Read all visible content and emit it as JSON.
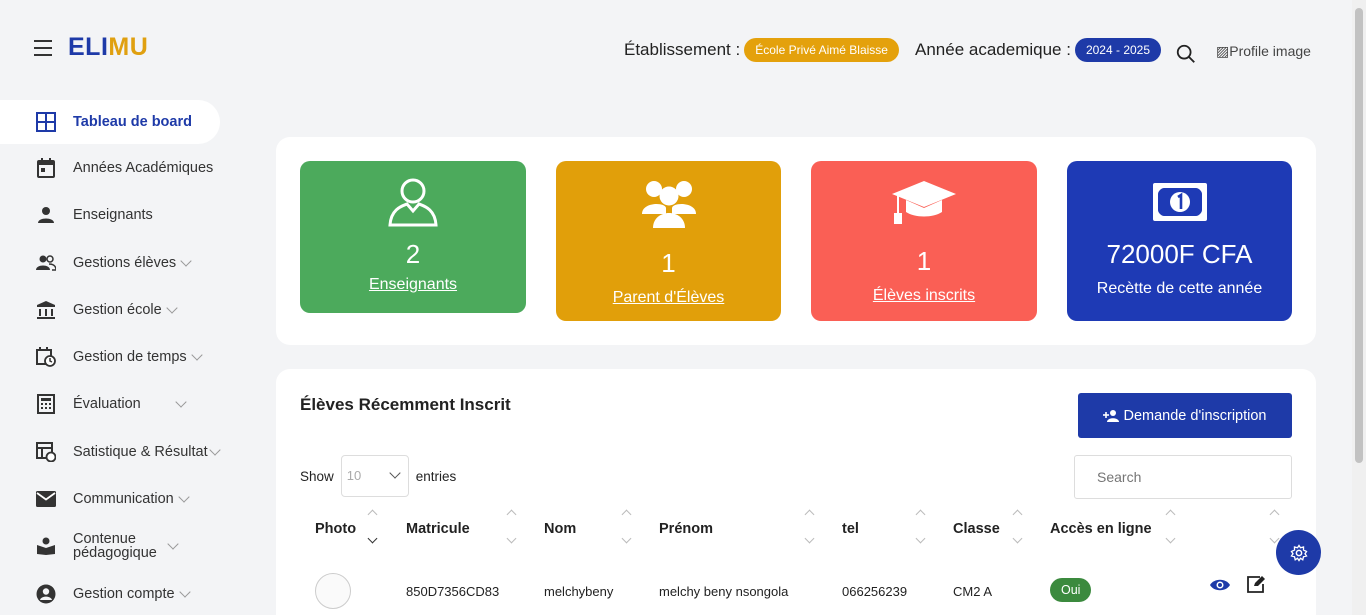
{
  "header": {
    "logo_part1": "ELI",
    "logo_part2": "MU",
    "etablissement_label": "Établissement :",
    "etablissement_value": "École Privé Aimé Blaisse",
    "annee_label": "Année academique :",
    "annee_value": "2024 - 2025",
    "profile_alt": "Profile image"
  },
  "sidebar": {
    "items": [
      {
        "label": "Tableau de board",
        "icon": "dashboard-icon"
      },
      {
        "label": "Années Académiques",
        "icon": "calendar-icon"
      },
      {
        "label": "Enseignants",
        "icon": "person-icon"
      },
      {
        "label": "Gestions élèves",
        "icon": "group-icon"
      },
      {
        "label": "Gestion école",
        "icon": "bank-icon"
      },
      {
        "label": "Gestion de temps",
        "icon": "schedule-icon"
      },
      {
        "label": "Évaluation",
        "icon": "calculator-icon"
      },
      {
        "label": "Satistique & Résultat",
        "icon": "statistics-icon"
      },
      {
        "label": "Communication",
        "icon": "mail-icon"
      },
      {
        "label": "Contenue",
        "label2": "pédagogique",
        "icon": "book-icon"
      },
      {
        "label": "Gestion compte",
        "icon": "account-icon"
      }
    ]
  },
  "stats": [
    {
      "value": "2",
      "label": "Enseignants",
      "color": "#4caa5c",
      "icon": "teacher-icon"
    },
    {
      "value": "1",
      "label": "Parent d'Élèves",
      "color": "#e19f0a",
      "icon": "parents-icon"
    },
    {
      "value": "1",
      "label": "Élèves inscrits",
      "color": "#fa5f55",
      "icon": "graduation-cap-icon"
    },
    {
      "value": "72000F CFA",
      "label": "Recètte de cette année",
      "color": "#1e3ab5",
      "icon": "money-icon"
    }
  ],
  "table": {
    "title": "Élèves Récemment Inscrit",
    "add_button": "Demande d'inscription",
    "show_label": "Show",
    "show_value": "10",
    "entries_label": "entries",
    "search_placeholder": "Search",
    "columns": [
      "Photo",
      "Matricule",
      "Nom",
      "Prénom",
      "tel",
      "Classe",
      "Accès en ligne"
    ],
    "rows": [
      {
        "matricule": "850D7356CD83",
        "nom": "melchybeny",
        "prenom": "melchy beny nsongola",
        "tel": "066256239",
        "classe": "CM2 A",
        "acces": "Oui"
      }
    ]
  }
}
